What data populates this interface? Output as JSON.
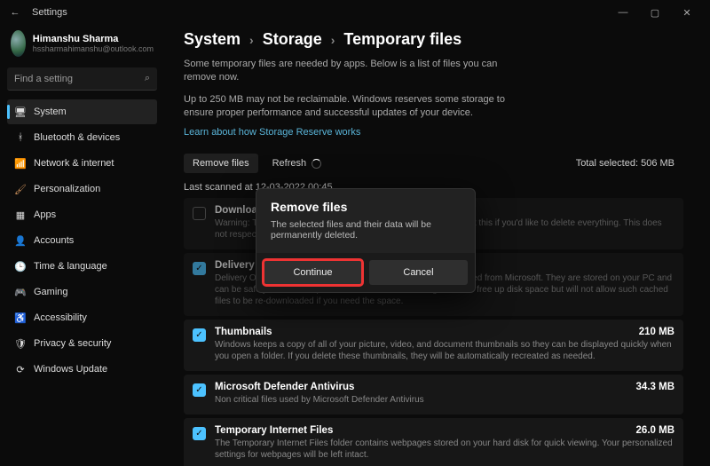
{
  "titlebar": {
    "title": "Settings"
  },
  "user": {
    "name": "Himanshu Sharma",
    "email": "hssharmahimanshu@outlook.com"
  },
  "search": {
    "placeholder": "Find a setting"
  },
  "nav": [
    {
      "icon": "🖥",
      "label": "System",
      "active": true
    },
    {
      "icon": "ᚼ",
      "label": "Bluetooth & devices"
    },
    {
      "icon": "📶",
      "label": "Network & internet",
      "color": "#4cc2ff"
    },
    {
      "icon": "🖌",
      "label": "Personalization",
      "color": "#c98f5a"
    },
    {
      "icon": "▦",
      "label": "Apps"
    },
    {
      "icon": "👤",
      "label": "Accounts"
    },
    {
      "icon": "🕒",
      "label": "Time & language"
    },
    {
      "icon": "🎮",
      "label": "Gaming"
    },
    {
      "icon": "♿",
      "label": "Accessibility"
    },
    {
      "icon": "🛡",
      "label": "Privacy & security"
    },
    {
      "icon": "⟳",
      "label": "Windows Update"
    }
  ],
  "breadcrumb": [
    "System",
    "Storage",
    "Temporary files"
  ],
  "intro1": "Some temporary files are needed by apps. Below is a list of files you can remove now.",
  "intro2": "Up to 250 MB may not be reclaimable. Windows reserves some storage to ensure proper performance and successful updates of your device.",
  "link": "Learn about how Storage Reserve works",
  "actions": {
    "remove": "Remove files",
    "refresh": "Refresh",
    "total_label": "Total selected:",
    "total_value": "506 MB"
  },
  "last_scan": "Last scanned at 12-03-2022 00:45",
  "items": [
    {
      "checked": false,
      "title": "Downloads",
      "size": "",
      "desc": "Warning: These are files in your personal Downloads folder. Select this if you'd like to delete everything. This does not respect your Storage Sense configuration."
    },
    {
      "checked": true,
      "title": "Delivery Optimization Files",
      "size": "",
      "desc": "Delivery Optimization files are files that were previously downloaded from Microsoft. They are stored on your PC and can be safely deleted or uploaded to other PCs. Deleting them will free up disk space but will not allow such cached files to be re-downloaded if you need the space."
    },
    {
      "checked": true,
      "title": "Thumbnails",
      "size": "210 MB",
      "desc": "Windows keeps a copy of all of your picture, video, and document thumbnails so they can be displayed quickly when you open a folder. If you delete these thumbnails, they will be automatically recreated as needed."
    },
    {
      "checked": true,
      "title": "Microsoft Defender Antivirus",
      "size": "34.3 MB",
      "desc": "Non critical files used by Microsoft Defender Antivirus"
    },
    {
      "checked": true,
      "title": "Temporary Internet Files",
      "size": "26.0 MB",
      "desc": "The Temporary Internet Files folder contains webpages stored on your hard disk for quick viewing. Your personalized settings for webpages will be left intact."
    }
  ],
  "modal": {
    "title": "Remove files",
    "body": "The selected files and their data will be permanently deleted.",
    "continue": "Continue",
    "cancel": "Cancel"
  }
}
